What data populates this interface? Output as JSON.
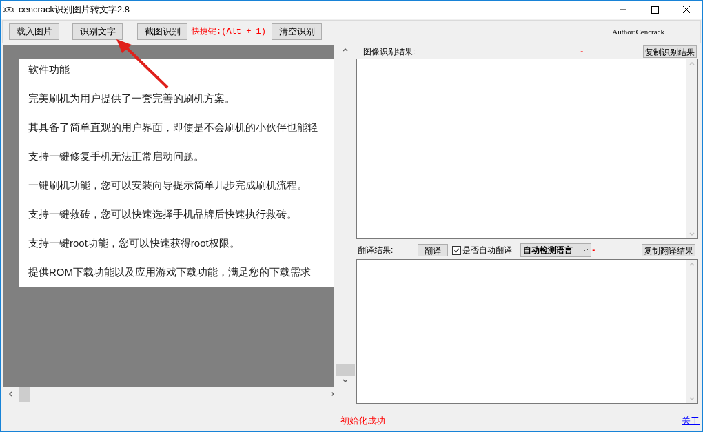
{
  "window": {
    "title": "cencrack识别图片转文字2.8"
  },
  "toolbar": {
    "buttons": [
      "载入图片",
      "识别文字",
      "截图识别"
    ],
    "shortcut": "快捷键:(Alt + 1)",
    "clear_button": "清空识别",
    "author": "Author:Cencrack"
  },
  "document": {
    "lines": [
      "软件功能",
      "完美刷机为用户提供了一套完善的刷机方案。",
      "其具备了简单直观的用户界面，即使是不会刷机的小伙伴也能轻",
      "支持一键修复手机无法正常启动问题。",
      "一键刷机功能，您可以安装向导提示简单几步完成刷机流程。",
      "支持一键救砖，您可以快速选择手机品牌后快速执行救砖。",
      "支持一键root功能，您可以快速获得root权限。",
      "提供ROM下载功能以及应用游戏下载功能，满足您的下载需求"
    ]
  },
  "ocr_result": {
    "label": "图像识别结果:",
    "marker": "-",
    "copy_button": "复制识别结果"
  },
  "translation": {
    "label": "翻译结果:",
    "translate_button": "翻译",
    "auto_translate": {
      "label": "是否自动翻译",
      "checked": true
    },
    "language": "自动检测语言",
    "marker": "-",
    "copy_button": "复制翻译结果"
  },
  "status_bar": {
    "message": "初始化成功",
    "about_link": "关于"
  }
}
